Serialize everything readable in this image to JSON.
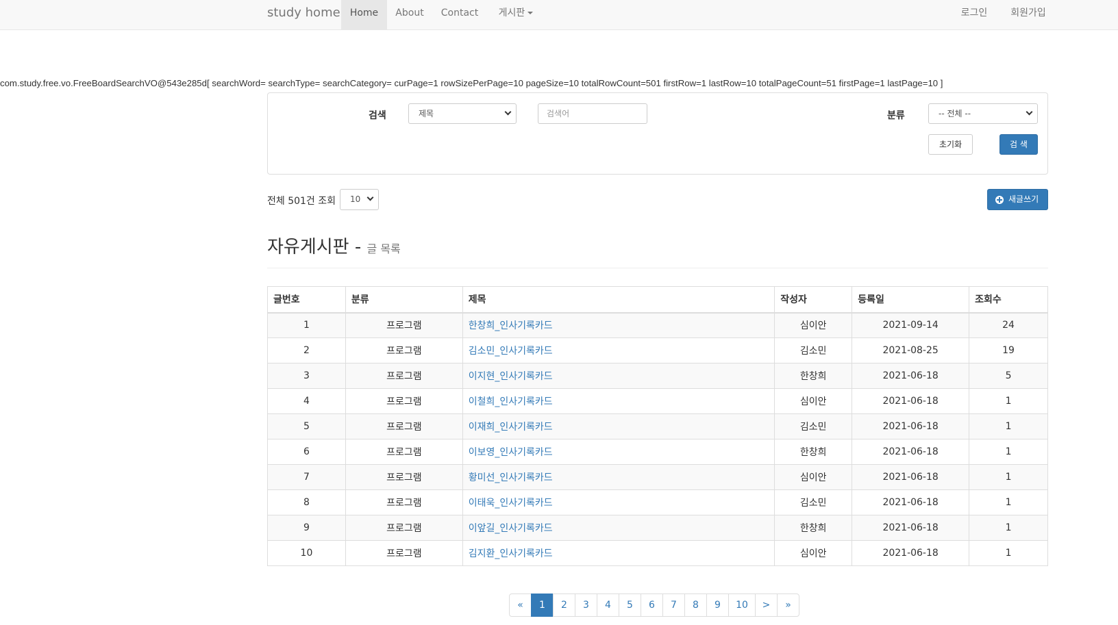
{
  "nav": {
    "brand": "study home",
    "items": [
      {
        "label": "Home"
      },
      {
        "label": "About"
      },
      {
        "label": "Contact"
      },
      {
        "label": "게시판"
      }
    ],
    "login": "로그인",
    "signup": "회원가입"
  },
  "debug_text": "com.study.free.vo.FreeBoardSearchVO@543e285d[ searchWord= searchType= searchCategory= curPage=1 rowSizePerPage=10 pageSize=10 totalRowCount=501 firstRow=1 lastRow=10 totalPageCount=51 firstPage=1 lastPage=10 ]",
  "search": {
    "label": "검색",
    "type_selected": "제목",
    "word_placeholder": "검색어",
    "category_label": "분류",
    "category_selected": "-- 전체 --",
    "reset_label": "초기화",
    "submit_label": "검 색"
  },
  "list_info": {
    "total_text": "전체 501건 조회",
    "rows_per_page": "10"
  },
  "new_post_label": "새글쓰기",
  "header": {
    "title": "자유게시판",
    "sep": " - ",
    "subtitle": "글 목록"
  },
  "table": {
    "columns": [
      "글번호",
      "분류",
      "제목",
      "작성자",
      "등록일",
      "조회수"
    ],
    "rows": [
      {
        "no": "1",
        "category": "프로그램",
        "title": "한창희_인사기록카드",
        "writer": "심이안",
        "date": "2021-09-14",
        "hits": "24"
      },
      {
        "no": "2",
        "category": "프로그램",
        "title": "김소민_인사기록카드",
        "writer": "김소민",
        "date": "2021-08-25",
        "hits": "19"
      },
      {
        "no": "3",
        "category": "프로그램",
        "title": "이지현_인사기록카드",
        "writer": "한창희",
        "date": "2021-06-18",
        "hits": "5"
      },
      {
        "no": "4",
        "category": "프로그램",
        "title": "이철희_인사기록카드",
        "writer": "심이안",
        "date": "2021-06-18",
        "hits": "1"
      },
      {
        "no": "5",
        "category": "프로그램",
        "title": "이재희_인사기록카드",
        "writer": "김소민",
        "date": "2021-06-18",
        "hits": "1"
      },
      {
        "no": "6",
        "category": "프로그램",
        "title": "이보영_인사기록카드",
        "writer": "한창희",
        "date": "2021-06-18",
        "hits": "1"
      },
      {
        "no": "7",
        "category": "프로그램",
        "title": "황미선_인사기록카드",
        "writer": "심이안",
        "date": "2021-06-18",
        "hits": "1"
      },
      {
        "no": "8",
        "category": "프로그램",
        "title": "이태욱_인사기록카드",
        "writer": "김소민",
        "date": "2021-06-18",
        "hits": "1"
      },
      {
        "no": "9",
        "category": "프로그램",
        "title": "이앞길_인사기록카드",
        "writer": "한창희",
        "date": "2021-06-18",
        "hits": "1"
      },
      {
        "no": "10",
        "category": "프로그램",
        "title": "김지환_인사기록카드",
        "writer": "심이안",
        "date": "2021-06-18",
        "hits": "1"
      }
    ]
  },
  "pagination": {
    "first": "«",
    "pages": [
      "1",
      "2",
      "3",
      "4",
      "5",
      "6",
      "7",
      "8",
      "9",
      "10"
    ],
    "next": ">",
    "last": "»",
    "current": "1"
  },
  "colors": {
    "primary": "#337ab7",
    "navbar_bg": "#f8f8f8",
    "active_nav_bg": "#e7e7e7"
  }
}
